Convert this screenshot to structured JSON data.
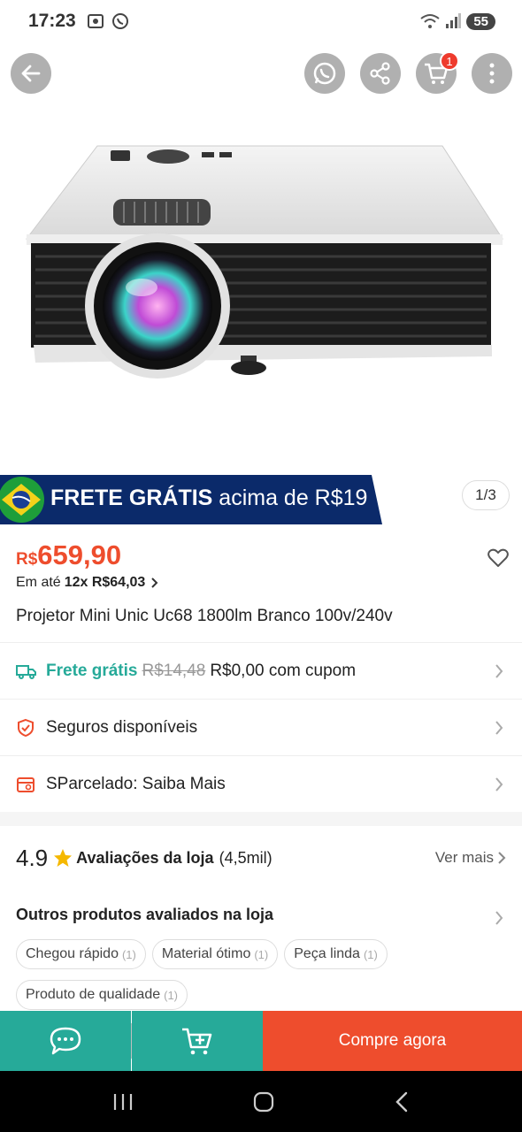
{
  "status_bar": {
    "time": "17:23",
    "battery": "55"
  },
  "nav": {
    "cart_count": "1"
  },
  "banner": {
    "main": "FRETE GRÁTIS",
    "sub": "acima de R$19"
  },
  "gallery": {
    "counter": "1/3"
  },
  "product": {
    "currency": "R$",
    "price": "659,90",
    "installment_prefix": "Em até",
    "installment_value": "12x R$64,03",
    "title": "Projetor Mini Unic Uc68 1800lm Branco 100v/240v"
  },
  "shipping": {
    "label": "Frete grátis",
    "old_price": "R$14,48",
    "new_price": "R$0,00 com cupom"
  },
  "insurance": {
    "label": "Seguros disponíveis"
  },
  "installments_info": {
    "label": "SParcelado: Saiba Mais"
  },
  "store_rating": {
    "score": "4.9",
    "label": "Avaliações da loja",
    "count": "(4,5mil)",
    "more": "Ver mais"
  },
  "other_products": {
    "title": "Outros produtos avaliados na loja",
    "tags": [
      {
        "label": "Chegou rápido",
        "count": "(1)"
      },
      {
        "label": "Material ótimo",
        "count": "(1)"
      },
      {
        "label": "Peça linda",
        "count": "(1)"
      },
      {
        "label": "Produto de qualidade",
        "count": "(1)"
      }
    ]
  },
  "actions": {
    "buy": "Compre agora"
  },
  "colors": {
    "accent": "#ee4d2d",
    "teal": "#26aa99",
    "banner": "#0b2a6a"
  }
}
